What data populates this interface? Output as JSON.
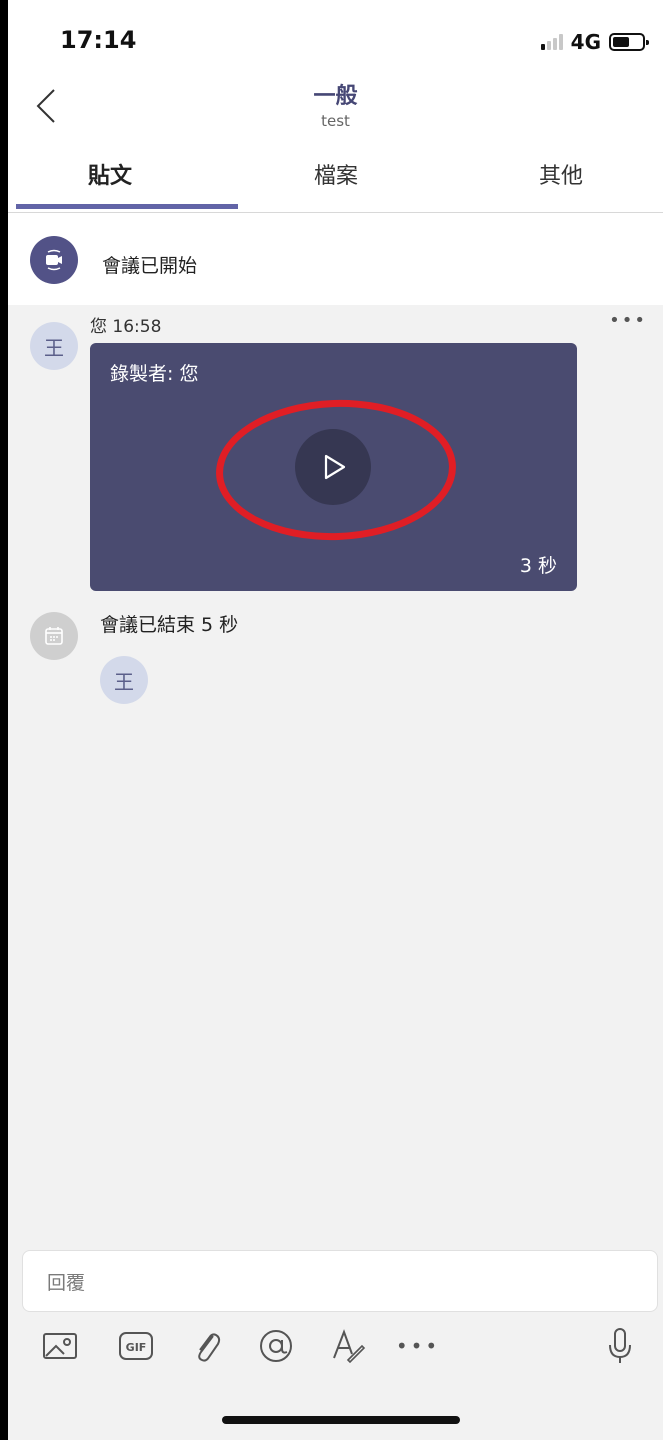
{
  "status_bar": {
    "time": "17:14",
    "network": "4G"
  },
  "header": {
    "title": "一般",
    "subtitle": "test"
  },
  "tabs": [
    {
      "label": "貼文",
      "active": true
    },
    {
      "label": "檔案",
      "active": false
    },
    {
      "label": "其他",
      "active": false
    }
  ],
  "events": {
    "meeting_started": "會議已開始",
    "meeting_ended": "會議已結束 5 秒"
  },
  "message": {
    "avatar_initial": "王",
    "sender_time": "您 16:58",
    "recorded_by": "錄製者: 您",
    "duration": "3 秒"
  },
  "participant": {
    "avatar_initial": "王"
  },
  "composer": {
    "placeholder": "回覆"
  },
  "colors": {
    "accent": "#6264a7",
    "card": "#4a4b70",
    "highlight": "#e01e25"
  },
  "icons": [
    "back-chevron-icon",
    "video-camera-icon",
    "play-icon",
    "calendar-icon",
    "image-icon",
    "gif-icon",
    "paperclip-icon",
    "at-icon",
    "format-icon",
    "more-icon",
    "microphone-icon"
  ]
}
